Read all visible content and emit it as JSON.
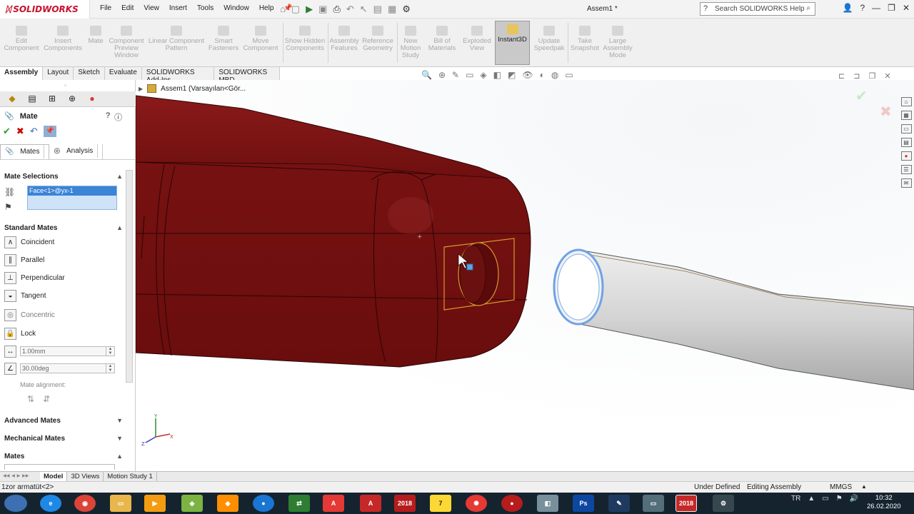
{
  "app": {
    "logo": "SOLIDWORKS",
    "doc_title": "Assem1 *"
  },
  "menu": [
    "File",
    "Edit",
    "View",
    "Insert",
    "Tools",
    "Window",
    "Help"
  ],
  "search": {
    "placeholder": "Search SOLIDWORKS Help"
  },
  "ribbon": [
    {
      "label": "Edit Component"
    },
    {
      "label": "Insert Components"
    },
    {
      "label": "Mate"
    },
    {
      "label": "Component Preview Window"
    },
    {
      "label": "Linear Component Pattern"
    },
    {
      "label": "Smart Fasteners"
    },
    {
      "label": "Move Component"
    },
    {
      "label": "Show Hidden Components"
    },
    {
      "label": "Assembly Features"
    },
    {
      "label": "Reference Geometry"
    },
    {
      "label": "New Motion Study"
    },
    {
      "label": "Bill of Materials"
    },
    {
      "label": "Exploded View"
    },
    {
      "label": "Instant3D"
    },
    {
      "label": "Update Speedpak"
    },
    {
      "label": "Take Snapshot"
    },
    {
      "label": "Large Assembly Mode"
    }
  ],
  "tabs": [
    "Assembly",
    "Layout",
    "Sketch",
    "Evaluate",
    "SOLIDWORKS Add-Ins",
    "SOLIDWORKS MBD"
  ],
  "property_manager": {
    "title": "Mate",
    "subtabs": [
      "Mates",
      "Analysis"
    ],
    "mate_selections_header": "Mate Selections",
    "selection_item": "Face<1>@yx-1",
    "standard_mates_header": "Standard Mates",
    "standard_mates": [
      "Coincident",
      "Parallel",
      "Perpendicular",
      "Tangent",
      "Concentric",
      "Lock"
    ],
    "distance_value": "1.00mm",
    "angle_value": "30.00deg",
    "mate_alignment_label": "Mate alignment:",
    "advanced_header": "Advanced Mates",
    "mechanical_header": "Mechanical Mates",
    "mates_header": "Mates"
  },
  "tree": {
    "breadcrumb": "Assem1  (Varsayılan<Gör..."
  },
  "bottom_tabs": [
    "Model",
    "3D Views",
    "Motion Study 1"
  ],
  "status": {
    "left": "1zor armatüt<2>",
    "state": "Under Defined",
    "mode": "Editing Assembly",
    "units": "MMGS"
  },
  "taskbar": {
    "lang": "TR",
    "time": "10:32",
    "date": "26.02.2020",
    "sw_label": "2018"
  },
  "colors": {
    "part_red": "#7a1414",
    "tube_gray": "#d9d9d9",
    "highlight": "#d79a2b",
    "edge_blue": "#6ea2e6"
  }
}
